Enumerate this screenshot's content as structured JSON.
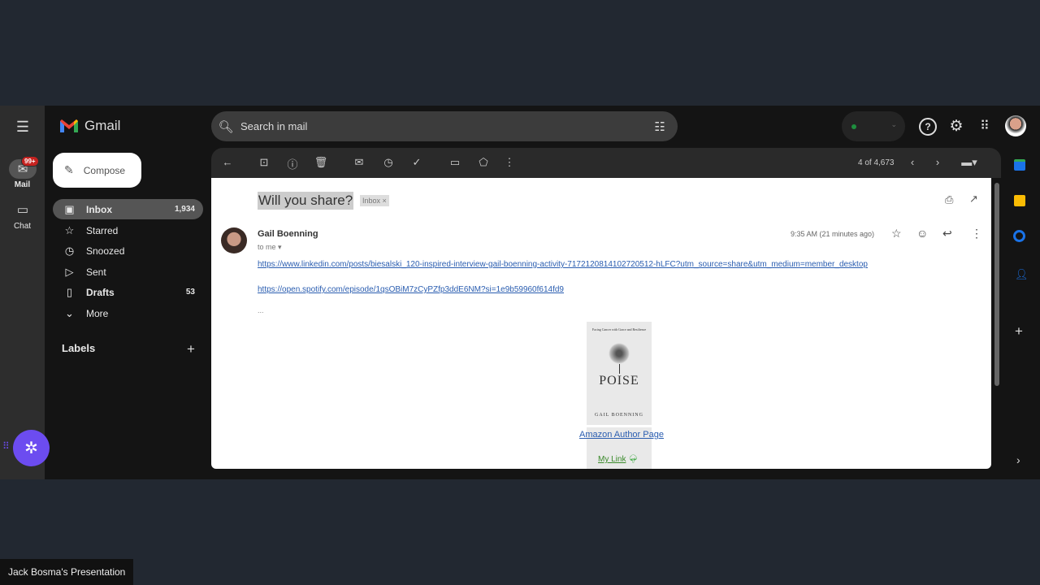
{
  "app": {
    "name": "Gmail"
  },
  "search": {
    "placeholder": "Search in mail"
  },
  "rail": [
    {
      "label": "Mail",
      "badge": "99+"
    },
    {
      "label": "Chat"
    }
  ],
  "compose": "Compose",
  "nav": [
    {
      "label": "Inbox",
      "count": "1,934",
      "icon": "inbox-icon"
    },
    {
      "label": "Starred",
      "count": "",
      "icon": "star-icon"
    },
    {
      "label": "Snoozed",
      "count": "",
      "icon": "clock-icon"
    },
    {
      "label": "Sent",
      "count": "",
      "icon": "send-icon"
    },
    {
      "label": "Drafts",
      "count": "53",
      "icon": "draft-icon"
    },
    {
      "label": "More",
      "count": "",
      "icon": "chevron-down-icon"
    }
  ],
  "labels": {
    "title": "Labels"
  },
  "toolbar": {
    "pagination": "4 of 4,673"
  },
  "email": {
    "subject": "Will you share?",
    "label_chip": "Inbox ×",
    "sender": "Gail Boenning",
    "to": "to me ▾",
    "time": "9:35 AM (21 minutes ago)",
    "link1": "https://www.linkedin.com/posts/biesalski_120-inspired-interview-gail-boenning-activity-7172120814102720512-hLFC?utm_source=share&utm_medium=member_desktop",
    "link2": "https://open.spotify.com/episode/1qsOBiM7zCyPZfp3ddE6NM?si=1e9b59960f614fd9",
    "ellipsis": "...",
    "book": {
      "subtitle": "Facing Cancer with Grace and Resilience",
      "title": "POISE",
      "author": "GAIL BOENNING"
    },
    "amazon": "Amazon Author Page",
    "mylink": "My Link"
  },
  "presenter": "Jack Bosma's Presentation",
  "colors": {
    "accent": "#1a73e8",
    "badge": "#c5221f",
    "fab": "#6c4cf0"
  }
}
